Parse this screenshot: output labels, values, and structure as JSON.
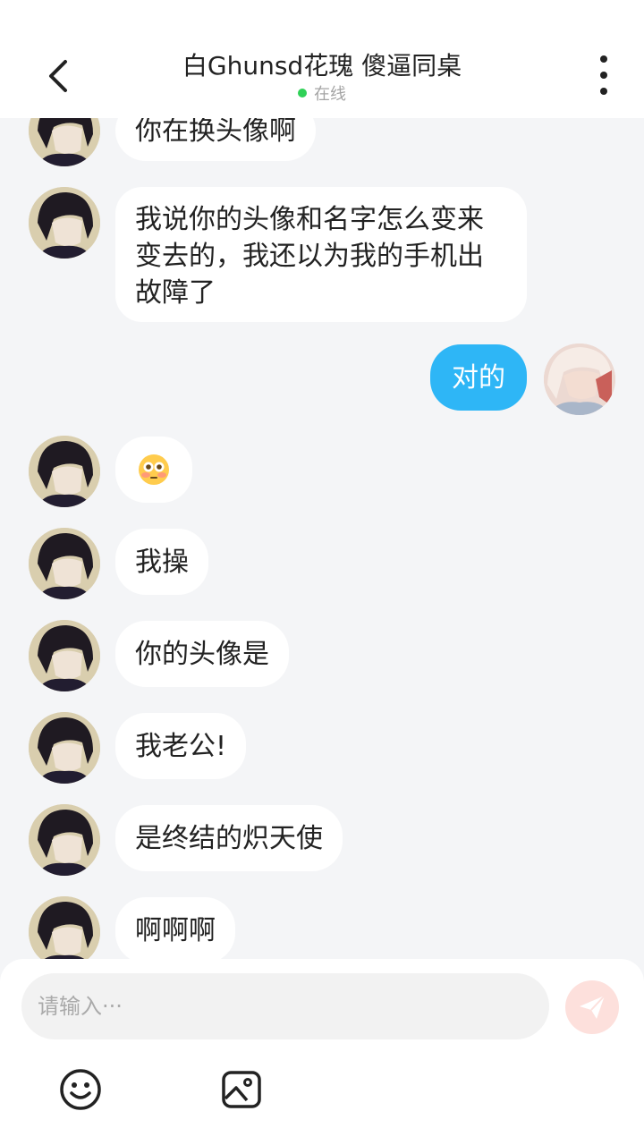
{
  "header": {
    "title": "白Ghunsd花瑰   傻逼同桌",
    "status_text": "在线",
    "back_icon": "chevron-left-icon",
    "more_icon": "more-vertical-icon",
    "status_color": "#2fd157"
  },
  "messages": [
    {
      "sender": "other",
      "text": "你在换头像啊"
    },
    {
      "sender": "other",
      "lines": [
        "我说你的头像和名字怎么变来",
        "变去的，我还以为我的手机出",
        "故障了"
      ]
    },
    {
      "sender": "me",
      "text": "对的"
    },
    {
      "sender": "other",
      "emoji": "flushed-face-emoji"
    },
    {
      "sender": "other",
      "text": "我操"
    },
    {
      "sender": "other",
      "text": "你的头像是"
    },
    {
      "sender": "other",
      "text": "我老公!"
    },
    {
      "sender": "other",
      "text": "是终结的炽天使"
    },
    {
      "sender": "other",
      "text": "啊啊啊"
    }
  ],
  "composer": {
    "placeholder": "请输入···",
    "value": "",
    "send_icon": "send-icon",
    "emoji_icon": "smiley-icon",
    "image_icon": "image-icon"
  },
  "colors": {
    "my_bubble": "#2eb6f6",
    "other_bubble": "#ffffff",
    "background": "#f4f5f7",
    "send_button": "#fde0dc"
  }
}
